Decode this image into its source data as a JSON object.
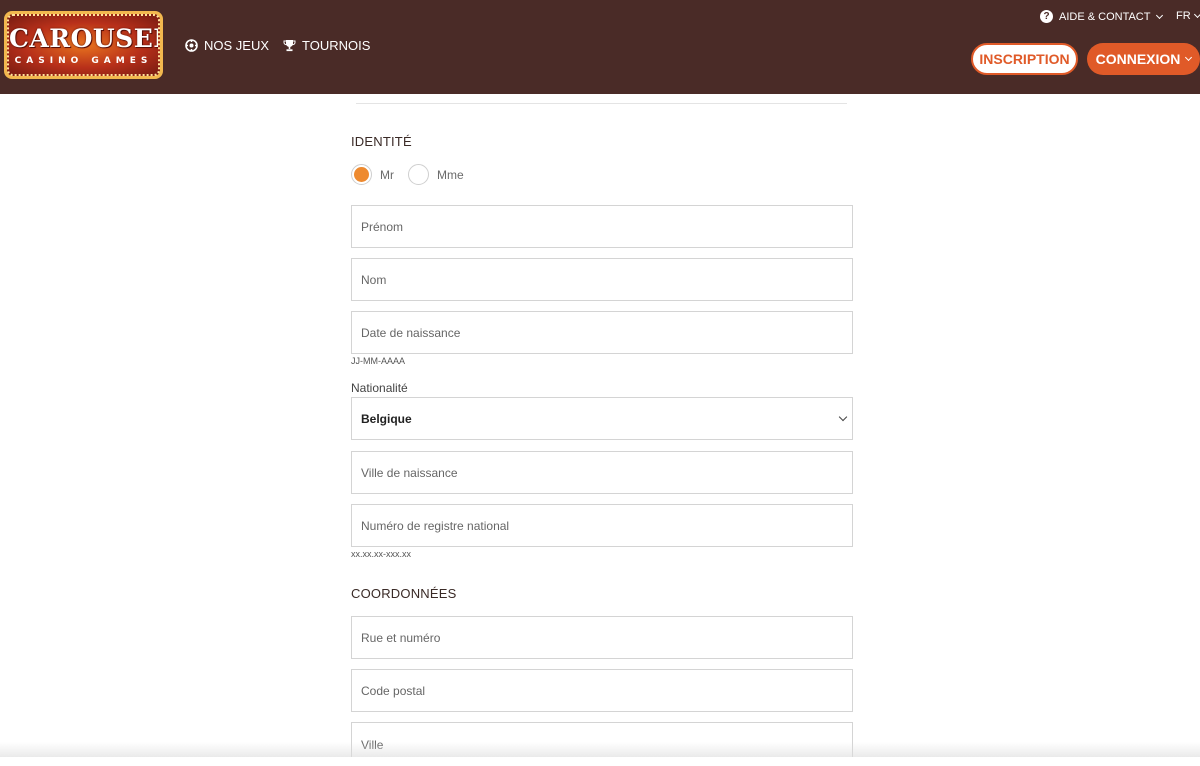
{
  "header": {
    "logo": {
      "title": "CAROUSEL",
      "subtitle": "CASINO GAMES"
    },
    "nav": [
      {
        "label": "NOS JEUX",
        "icon": "chip-icon"
      },
      {
        "label": "TOURNOIS",
        "icon": "trophy-icon"
      }
    ],
    "help": {
      "label": "AIDE & CONTACT",
      "icon": "question-icon"
    },
    "language": "FR",
    "register_button": "INSCRIPTION",
    "login_button": "CONNEXION"
  },
  "form": {
    "identity_title": "IDENTITÉ",
    "gender": {
      "options": [
        "Mr",
        "Mme"
      ],
      "selected": "Mr"
    },
    "first_name": {
      "placeholder": "Prénom",
      "value": ""
    },
    "last_name": {
      "placeholder": "Nom",
      "value": ""
    },
    "birth_date": {
      "placeholder": "Date de naissance",
      "value": "",
      "hint": "JJ-MM-AAAA"
    },
    "nationality": {
      "label": "Nationalité",
      "value": "Belgique"
    },
    "birth_city": {
      "placeholder": "Ville de naissance",
      "value": ""
    },
    "national_register": {
      "placeholder": "Numéro de registre national",
      "value": "",
      "hint": "xx.xx.xx-xxx.xx"
    },
    "contact_title": "COORDONNÉES",
    "street": {
      "placeholder": "Rue et numéro",
      "value": ""
    },
    "postal_code": {
      "placeholder": "Code postal",
      "value": ""
    },
    "city": {
      "placeholder": "Ville",
      "value": ""
    }
  },
  "colors": {
    "header_bg": "#4a2b27",
    "accent": "#e05a28",
    "radio_checked": "#ee8a2f"
  }
}
